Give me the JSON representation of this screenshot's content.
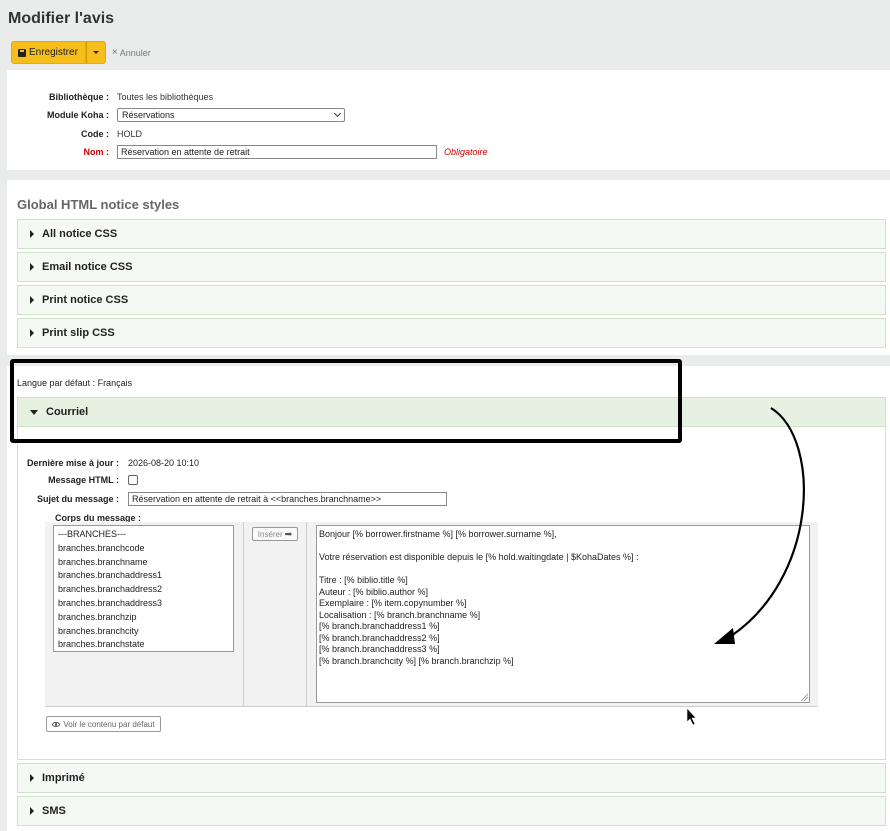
{
  "page": {
    "title": "Modifier l'avis"
  },
  "toolbar": {
    "save_label": "Enregistrer",
    "cancel_label": "Annuler"
  },
  "form": {
    "library_label": "Bibliothèque :",
    "library_value": "Toutes les bibliothèques",
    "module_label": "Module Koha :",
    "module_value": "Réservations",
    "code_label": "Code :",
    "code_value": "HOLD",
    "name_label": "Nom :",
    "name_value": "Réservation en attente de retrait",
    "required_note": "Obligatoire"
  },
  "global_styles": {
    "title": "Global HTML notice styles",
    "items": [
      {
        "label": "All notice CSS"
      },
      {
        "label": "Email notice CSS"
      },
      {
        "label": "Print notice CSS"
      },
      {
        "label": "Print slip CSS"
      }
    ]
  },
  "language": {
    "label": "Langue par défaut : Français"
  },
  "email": {
    "header": "Courriel",
    "last_updated_label": "Dernière mise à jour :",
    "last_updated_value": "2026-08-20 10:10",
    "html_label": "Message HTML :",
    "html_checked": false,
    "subject_label": "Sujet du message :",
    "subject_value": "Réservation en attente de retrait à <<branches.branchname>>",
    "body_label": "Corps du message :",
    "fields": [
      "---BRANCHES---",
      "branches.branchcode",
      "branches.branchname",
      "branches.branchaddress1",
      "branches.branchaddress2",
      "branches.branchaddress3",
      "branches.branchzip",
      "branches.branchcity",
      "branches.branchstate"
    ],
    "insert_label": "Insérer",
    "body_lines": [
      "Bonjour [% borrower.firstname %] [% borrower.surname %],",
      "",
      "Votre réservation est disponible depuis le [% hold.waitingdate | $KohaDates %] :",
      "",
      "Titre : [% biblio.title %]",
      "Auteur : [% biblio.author %]",
      "Exemplaire : [% item.copynumber %]",
      "Localisation : [% branch.branchname %]",
      "[% branch.branchaddress1 %]",
      "[% branch.branchaddress2 %]",
      "[% branch.branchaddress3 %]",
      "[% branch.branchcity %] [% branch.branchzip %]"
    ],
    "view_default_label": "Voir le contenu par défaut"
  },
  "other_transports": [
    {
      "label": "Imprimé"
    },
    {
      "label": "SMS"
    }
  ],
  "colors": {
    "accent": "#f5be1a",
    "required": "#cc0000",
    "accordion_bg": "#f5f9f4",
    "accordion_border": "#cfe3c9"
  }
}
